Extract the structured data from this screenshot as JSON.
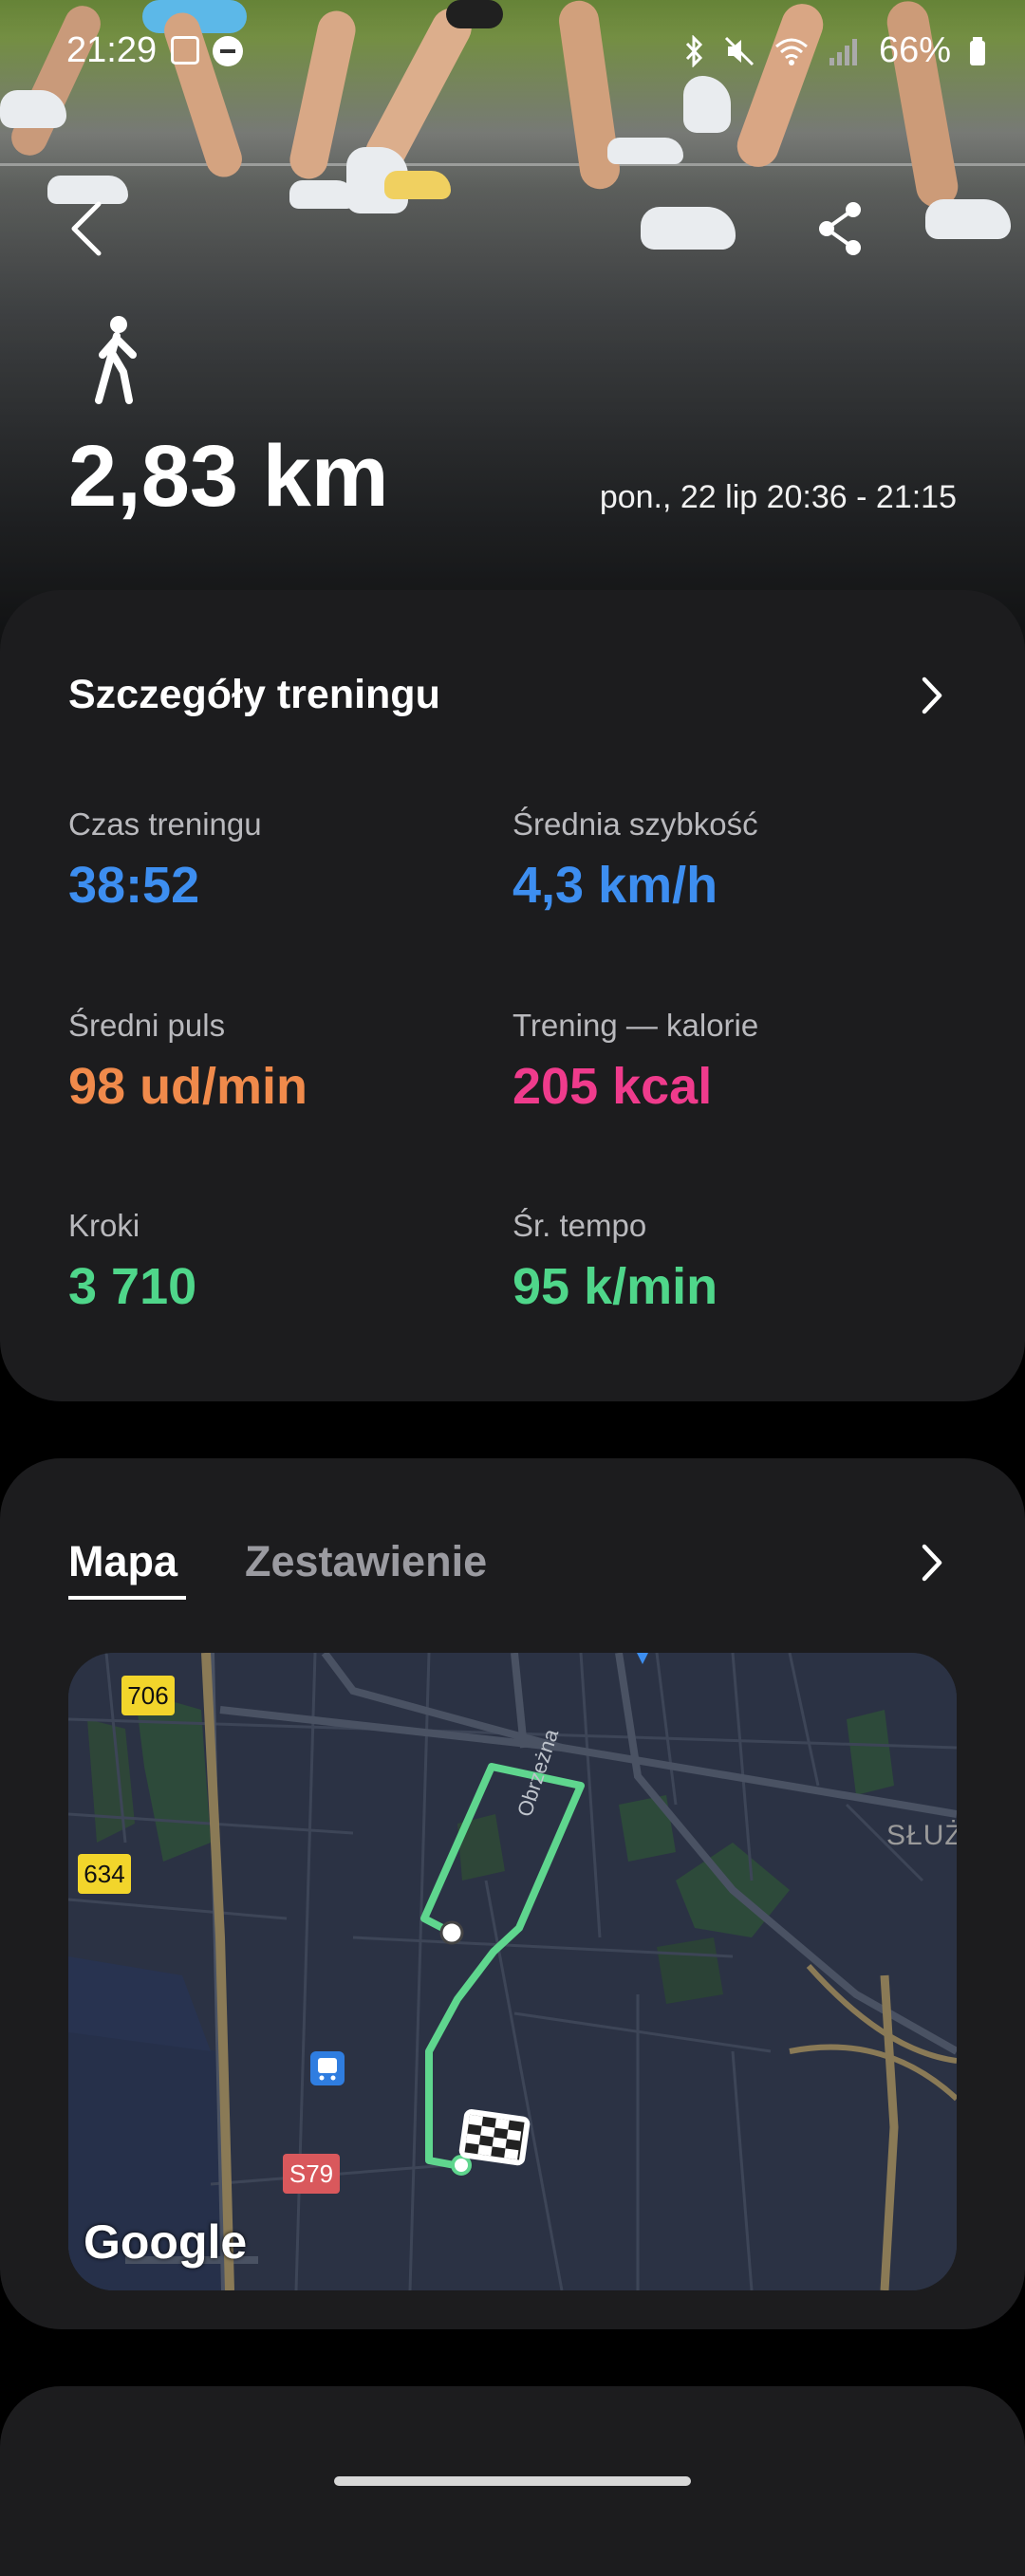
{
  "status_bar": {
    "time": "21:29",
    "battery": "66%"
  },
  "header": {
    "activity_icon": "walking-person-icon",
    "distance": "2,83 km",
    "datetime": "pon., 22 lip 20:36 - 21:15"
  },
  "details": {
    "title": "Szczegóły treningu",
    "stats": [
      {
        "label": "Czas treningu",
        "value": "38:52",
        "color": "#3d8ef0"
      },
      {
        "label": "Średnia szybkość",
        "value": "4,3 km/h",
        "color": "#3d8ef0"
      },
      {
        "label": "Średni puls",
        "value": "98 ud/min",
        "color": "#f08a4b"
      },
      {
        "label": "Trening — kalorie",
        "value": "205 kcal",
        "color": "#ef3b8c"
      },
      {
        "label": "Kroki",
        "value": "3 710",
        "color": "#4fd68a"
      },
      {
        "label": "Śr. tempo",
        "value": "95 k/min",
        "color": "#4fd68a"
      }
    ]
  },
  "map_section": {
    "tabs": [
      {
        "label": "Mapa",
        "active": true
      },
      {
        "label": "Zestawienie",
        "active": false
      }
    ],
    "map": {
      "road_labels": [
        "706",
        "634",
        "S79"
      ],
      "street_label": "Obrzeżna",
      "district_label": "SŁUŻ",
      "provider_logo": "Google",
      "route_color": "#5fd68e"
    }
  }
}
